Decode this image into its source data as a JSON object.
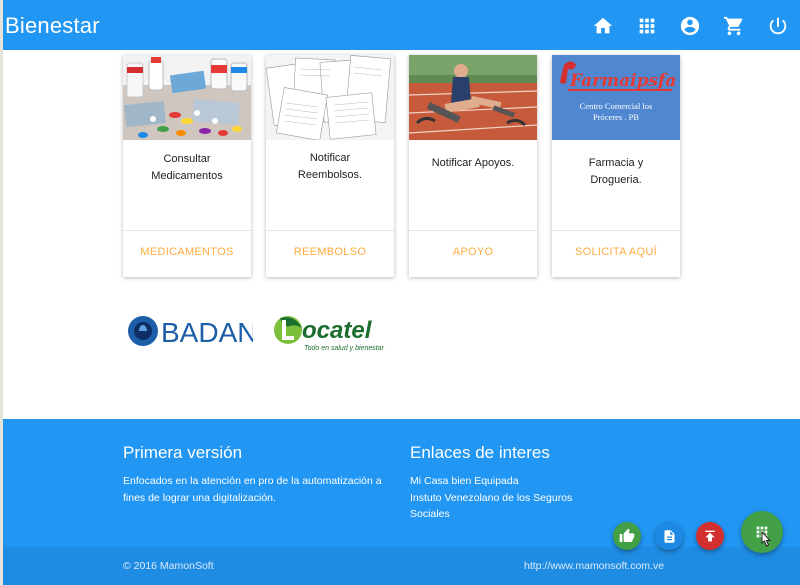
{
  "header": {
    "title": "Bienestar",
    "icons": [
      "home-icon",
      "apps-icon",
      "account-icon",
      "cart-icon",
      "power-icon"
    ]
  },
  "cards": [
    {
      "title": "Consultar Medicamentos",
      "action": "MEDICAMENTOS",
      "image": "medicine-pills-photo"
    },
    {
      "title": "Notificar Reembolsos.",
      "action": "REEMBOLSO",
      "image": "forms-documents-photo"
    },
    {
      "title": "Notificar Apoyos.",
      "action": "APOYO",
      "image": "athlete-track-photo"
    },
    {
      "title": "Farmacia y Drogueria.",
      "action": "SOLICITA AQUÍ",
      "image": "farmaipsfa-logo",
      "logo_text": "Farmaipsfa",
      "logo_subtitle": "Centro Comercial los Próceres . PB"
    }
  ],
  "partners": {
    "badan": "BADAN",
    "locatel": "Locatel",
    "locatel_tagline": "Todo en salud y bienestar"
  },
  "footer": {
    "col1_title": "Primera versión",
    "col1_text": "Enfocados en la atención en pro de la automatización a fines de lograr una digitalización.",
    "col2_title": "Enlaces de interes",
    "links": [
      "Mi Casa bien Equipada",
      "Instuto Venezolano de los Seguros Sociales"
    ],
    "copyright": "© 2016 MamonSoft",
    "url": "http://www.mamonsoft.com.ve"
  },
  "colors": {
    "primary": "#2196f3",
    "accent": "#ffab40",
    "fab_like": "#43a047",
    "fab_doc": "#1e88e5",
    "fab_top": "#d32f2f",
    "fab_main": "#43a047"
  },
  "fabs": [
    "thumb-up-icon",
    "document-icon",
    "publish-icon",
    "apps-icon"
  ]
}
